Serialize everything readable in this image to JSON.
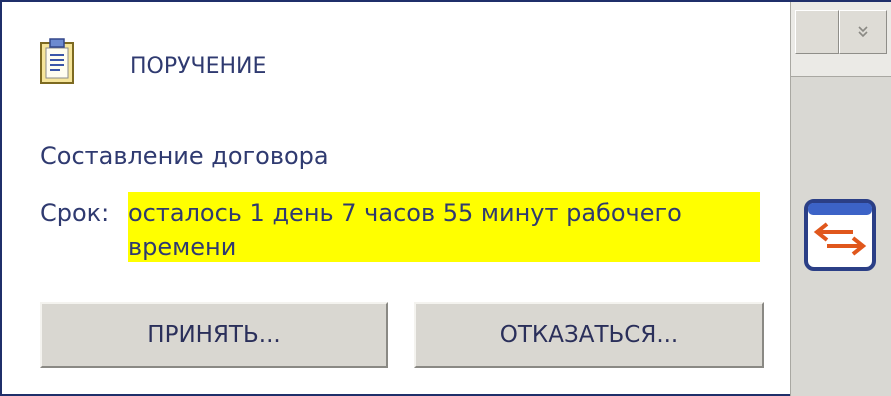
{
  "task": {
    "title": "ПОРУЧЕНИЕ",
    "subject": "Составление договора",
    "deadline_label": "Срок:",
    "deadline_value": "осталось 1 день 7 часов 55 минут рабочего времени"
  },
  "buttons": {
    "accept": "ПРИНЯТЬ...",
    "decline": "ОТКАЗАТЬСЯ..."
  },
  "icons": {
    "task": "document-clipboard-icon",
    "expand": "double-chevron-down-icon",
    "switch": "swap-arrows-icon"
  },
  "colors": {
    "highlight": "#ffff00",
    "text": "#2f3a70",
    "frame": "#1f2f6a",
    "switch_accent": "#e0571c"
  }
}
